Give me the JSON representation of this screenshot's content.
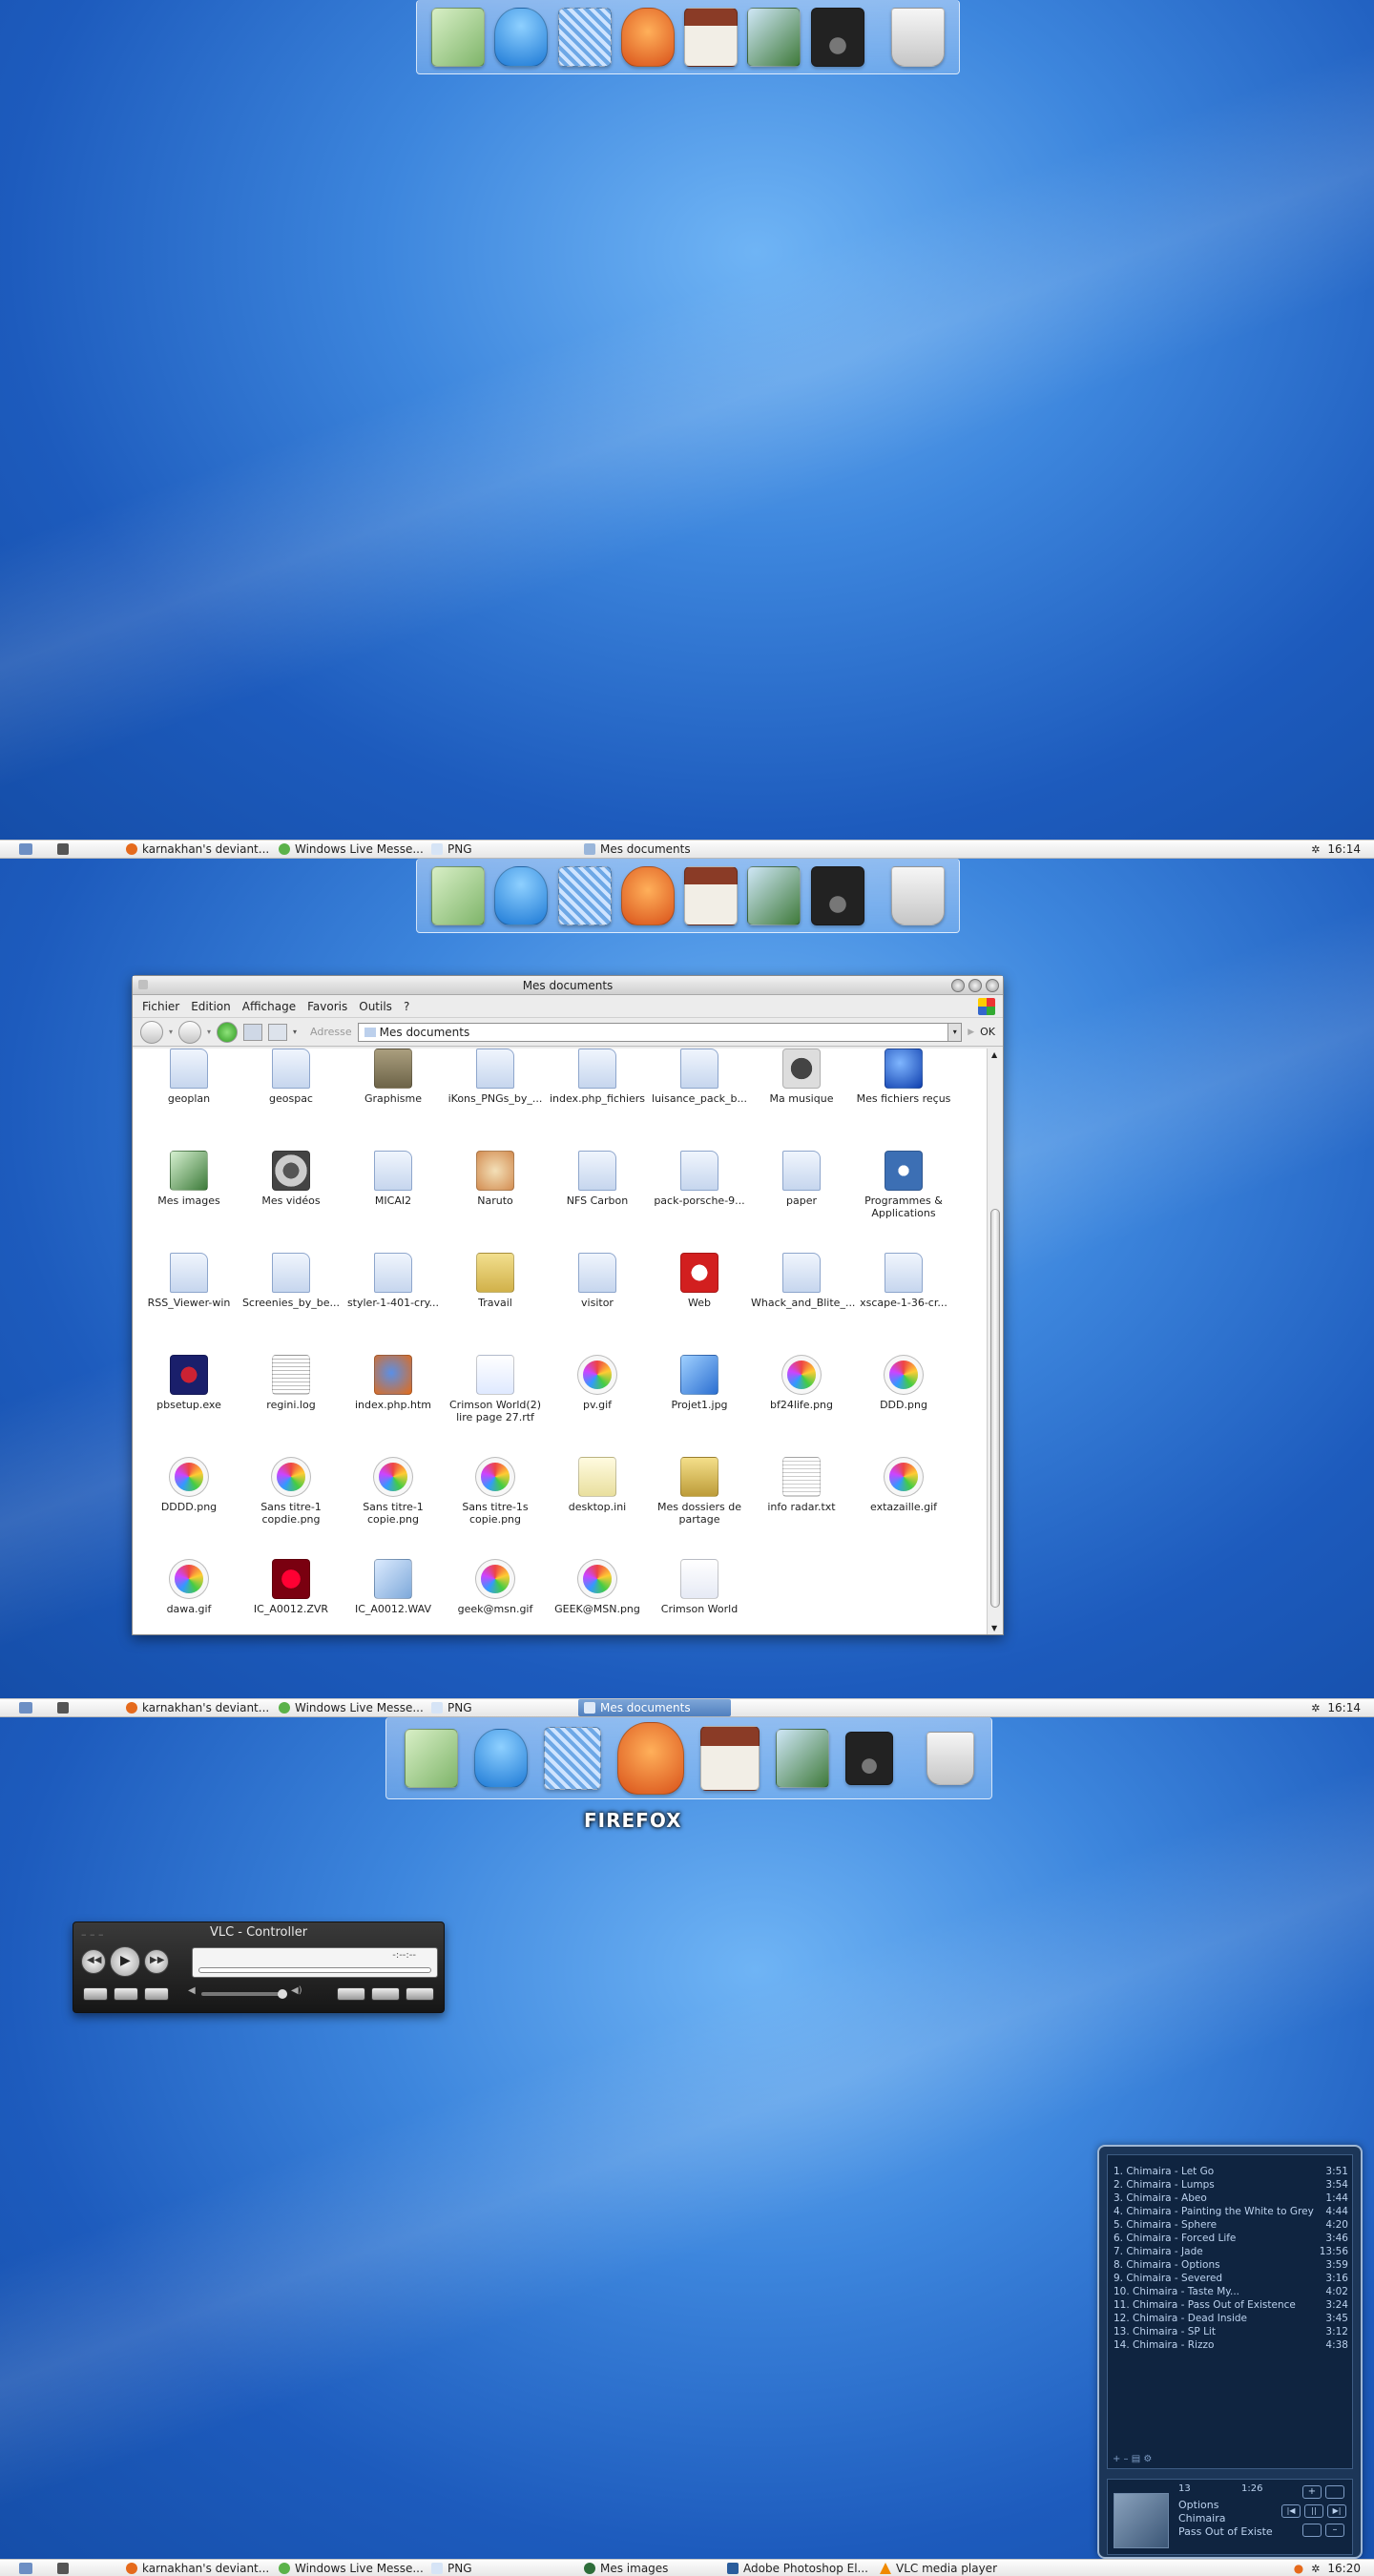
{
  "screen1": {
    "taskbar": {
      "tasks": [
        "karnakhan's deviant...",
        "Windows Live Messe...",
        "PNG",
        "Mes documents"
      ],
      "clock": "16:14"
    }
  },
  "screen2": {
    "window": {
      "title": "Mes documents",
      "menu": [
        "Fichier",
        "Edition",
        "Affichage",
        "Favoris",
        "Outils",
        "?"
      ],
      "address_label": "Adresse",
      "address_value": "Mes documents",
      "ok_label": "OK"
    },
    "files": [
      "geoplan",
      "geospac",
      "Graphisme",
      "iKons_PNGs_by_...",
      "index.php_fichiers",
      "luisance_pack_b...",
      "Ma musique",
      "Mes fichiers reçus",
      "Mes images",
      "Mes vidéos",
      "MICAI2",
      "Naruto",
      "NFS Carbon",
      "pack-porsche-9...",
      "paper",
      "Programmes & Applications",
      "RSS_Viewer-win",
      "Screenies_by_be...",
      "styler-1-401-cry...",
      "Travail",
      "visitor",
      "Web",
      "Whack_and_Blite_...",
      "xscape-1-36-cr...",
      "pbsetup.exe",
      "regini.log",
      "index.php.htm",
      "Crimson World(2) lire page 27.rtf",
      "pv.gif",
      "Projet1.jpg",
      "bf24life.png",
      "DDD.png",
      "DDDD.png",
      "Sans titre-1 copdie.png",
      "Sans titre-1 copie.png",
      "Sans titre-1s copie.png",
      "desktop.ini",
      "Mes dossiers de partage",
      "info radar.txt",
      "extazaille.gif",
      "dawa.gif",
      "IC_A0012.ZVR",
      "IC_A0012.WAV",
      "geek@msn.gif",
      "GEEK@MSN.png",
      "Crimson World"
    ],
    "taskbar": {
      "tasks": [
        "karnakhan's deviant...",
        "Windows Live Messe...",
        "PNG",
        "Mes documents"
      ],
      "clock": "16:14"
    }
  },
  "screen3": {
    "dock_label": "FIREFOX",
    "vlc": {
      "title": "VLC - Controller",
      "time": "-:--:--"
    },
    "player": {
      "tracks": [
        {
          "title": "1. Chimaira - Let Go",
          "time": "3:51"
        },
        {
          "title": "2. Chimaira - Lumps",
          "time": "3:54"
        },
        {
          "title": "3. Chimaira - Abeo",
          "time": "1:44"
        },
        {
          "title": "4. Chimaira - Painting the White to Grey",
          "time": "4:44"
        },
        {
          "title": "5. Chimaira - Sphere",
          "time": "4:20"
        },
        {
          "title": "6. Chimaira - Forced Life",
          "time": "3:46"
        },
        {
          "title": "7. Chimaira - Jade",
          "time": "13:56"
        },
        {
          "title": "8. Chimaira - Options",
          "time": "3:59"
        },
        {
          "title": "9. Chimaira - Severed",
          "time": "3:16"
        },
        {
          "title": "10. Chimaira - Taste My...",
          "time": "4:02"
        },
        {
          "title": "11. Chimaira - Pass Out of Existence",
          "time": "3:24"
        },
        {
          "title": "12. Chimaira - Dead Inside",
          "time": "3:45"
        },
        {
          "title": "13. Chimaira - SP Lit",
          "time": "3:12"
        },
        {
          "title": "14. Chimaira - Rizzo",
          "time": "4:38"
        }
      ],
      "now_track_no": "13",
      "now_time": "1:26",
      "now_title": "Options",
      "now_artist": "Chimaira",
      "now_album": "Pass Out of Existe"
    },
    "taskbar": {
      "tasks": [
        "karnakhan's deviant...",
        "Windows Live Messe...",
        "PNG",
        "Mes images",
        "Adobe Photoshop El...",
        "VLC media player"
      ],
      "clock": "16:20"
    }
  }
}
